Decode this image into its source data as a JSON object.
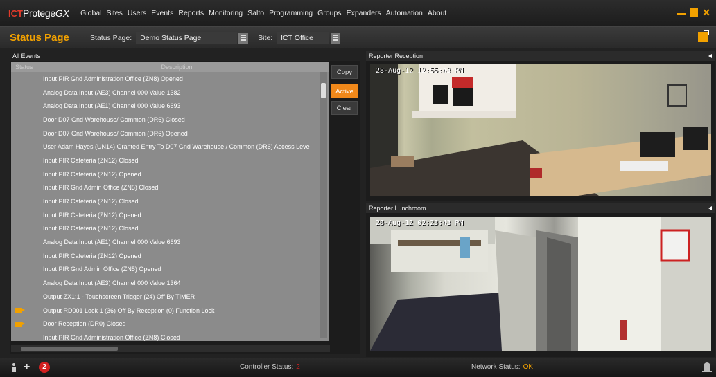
{
  "app": {
    "logo_ict": "ICT",
    "logo_name": "Protege",
    "logo_gx": "GX",
    "menu": [
      "Global",
      "Sites",
      "Users",
      "Events",
      "Reports",
      "Monitoring",
      "Salto",
      "Programming",
      "Groups",
      "Expanders",
      "Automation",
      "About"
    ]
  },
  "toolbar": {
    "page_title": "Status Page",
    "status_page_label": "Status Page:",
    "status_page_value": "Demo Status Page",
    "site_label": "Site:",
    "site_value": "ICT Office"
  },
  "events": {
    "panel_title": "All Events",
    "col_status": "Status",
    "col_description": "Description",
    "rows": [
      {
        "icon": "",
        "text": "Input PIR Gnd Administration Office (ZN8) Opened"
      },
      {
        "icon": "",
        "text": "Analog Data Input (AE3) Channel 000 Value 1382"
      },
      {
        "icon": "",
        "text": "Analog Data Input (AE1) Channel 000 Value 6693"
      },
      {
        "icon": "",
        "text": "Door D07 Gnd Warehouse/ Common (DR6) Closed"
      },
      {
        "icon": "",
        "text": "Door D07 Gnd Warehouse/ Common (DR6) Opened"
      },
      {
        "icon": "",
        "text": "User Adam Hayes (UN14) Granted Entry To D07 Gnd Warehouse / Common (DR6) Access Leve"
      },
      {
        "icon": "",
        "text": "Input PIR Cafeteria (ZN12) Closed"
      },
      {
        "icon": "",
        "text": "Input PIR Cafeteria (ZN12) Opened"
      },
      {
        "icon": "",
        "text": "Input PIR Gnd Admin Office (ZN5) Closed"
      },
      {
        "icon": "",
        "text": "Input PIR Cafeteria (ZN12) Closed"
      },
      {
        "icon": "",
        "text": "Input PIR Cafeteria (ZN12) Opened"
      },
      {
        "icon": "",
        "text": "Input PIR Cafeteria (ZN12) Closed"
      },
      {
        "icon": "",
        "text": "Analog Data Input (AE1) Channel 000 Value 6693"
      },
      {
        "icon": "",
        "text": "Input PIR Cafeteria (ZN12) Opened"
      },
      {
        "icon": "",
        "text": "Input PIR Gnd Admin Office (ZN5) Opened"
      },
      {
        "icon": "",
        "text": "Analog Data Input (AE3) Channel 000 Value 1364"
      },
      {
        "icon": "",
        "text": "Output ZX1:1 - Touchscreen Trigger (24) Off By TIMER"
      },
      {
        "icon": "camera-icon",
        "text": "Output RD001 Lock 1 (36) Off By Reception (0) Function Lock"
      },
      {
        "icon": "camera-icon",
        "text": "Door Reception (DR0) Closed"
      },
      {
        "icon": "",
        "text": "Input PIR Gnd Administration Office (ZN8) Closed"
      }
    ],
    "buttons": {
      "copy": "Copy",
      "active": "Active",
      "clear": "Clear"
    }
  },
  "cameras": [
    {
      "title": "Reporter Reception",
      "timestamp": "28-Aug-12 12:55:43 PM"
    },
    {
      "title": "Reporter Lunchroom",
      "timestamp": "28-Aug-12 02:23:43 PM"
    }
  ],
  "footer": {
    "alarm_count": "2",
    "controller_status_label": "Controller Status:",
    "controller_status_value": "2",
    "network_status_label": "Network Status:",
    "network_status_value": "OK"
  },
  "colors": {
    "accent": "#f2a100",
    "active_button": "#f0881a",
    "alarm": "#d32020"
  }
}
